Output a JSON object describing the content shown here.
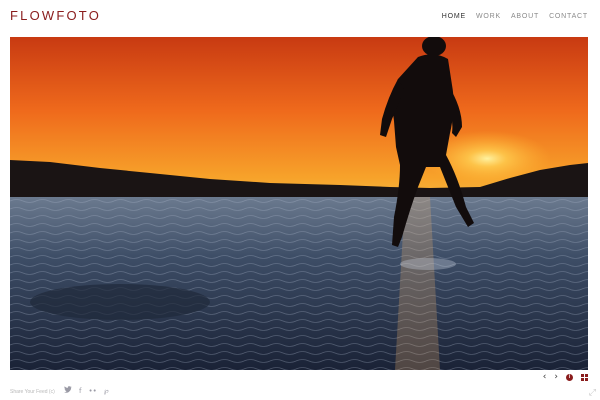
{
  "site": {
    "logo": "FLOWFOTO"
  },
  "nav": {
    "items": [
      {
        "label": "HOME",
        "active": true
      },
      {
        "label": "WORK",
        "active": false
      },
      {
        "label": "ABOUT",
        "active": false
      },
      {
        "label": "CONTACT",
        "active": false
      }
    ]
  },
  "slideshow": {
    "controls": {
      "prev_icon": "‹",
      "next_icon": "›",
      "info_icon": "i"
    }
  },
  "footer": {
    "credit": "Share Your Feed (c)",
    "social": [
      "twitter-icon",
      "facebook-icon",
      "flickr-icon",
      "pinterest-icon"
    ],
    "social_glyphs": [
      "🐦",
      "f",
      "••",
      "℘"
    ]
  },
  "colors": {
    "brand": "#8a1c1c",
    "nav_active": "#333333",
    "nav": "#8a8a8a"
  }
}
